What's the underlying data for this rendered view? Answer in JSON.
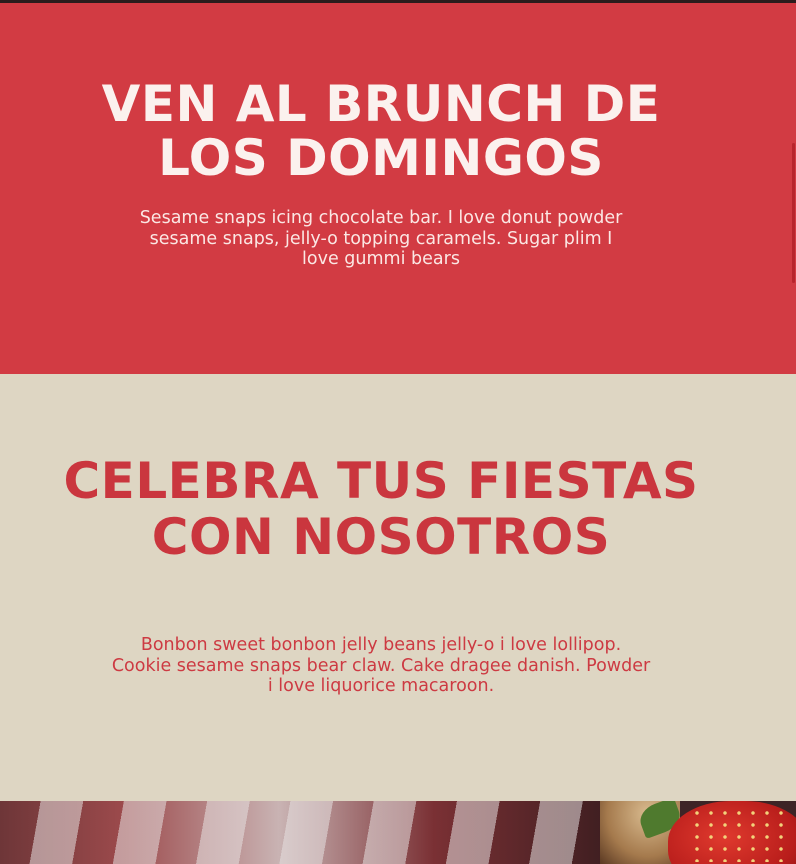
{
  "brunch": {
    "title": "VEN AL BRUNCH DE LOS DOMINGOS",
    "text": "Sesame snaps icing chocolate bar. I love donut powder sesame snaps, jelly-o topping caramels. Sugar plim I love gummi bears"
  },
  "fiestas": {
    "title": "CELEBRA TUS FIESTAS CON NOSOTROS",
    "text": "Bonbon sweet bonbon jelly beans jelly-o i love lollipop. Cookie sesame snaps bear claw. Cake dragee danish. Powder i love liquorice macaroon."
  },
  "colors": {
    "brand_red": "#d23b43",
    "cream": "#ded6c3",
    "heading_light": "#fbf1ee"
  },
  "photo": {
    "icon": "food-photo-strawberry-tablecloth"
  }
}
